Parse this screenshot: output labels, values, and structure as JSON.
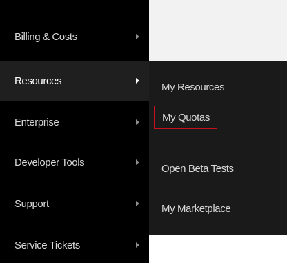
{
  "menu": {
    "items": [
      {
        "label": "Billing & Costs"
      },
      {
        "label": "Resources"
      },
      {
        "label": "Enterprise"
      },
      {
        "label": "Developer Tools"
      },
      {
        "label": "Support"
      },
      {
        "label": "Service Tickets"
      }
    ],
    "active_index": 1
  },
  "submenu": {
    "items": [
      {
        "label": "My Resources"
      },
      {
        "label": "My Quotas"
      },
      {
        "label": "Open Beta Tests"
      },
      {
        "label": "My Marketplace"
      }
    ],
    "highlighted_index": 1,
    "highlight_color": "#c8101f"
  },
  "colors": {
    "menu_background": "#000000",
    "submenu_background": "#1a1a1a",
    "text": "#d7d7d7"
  }
}
